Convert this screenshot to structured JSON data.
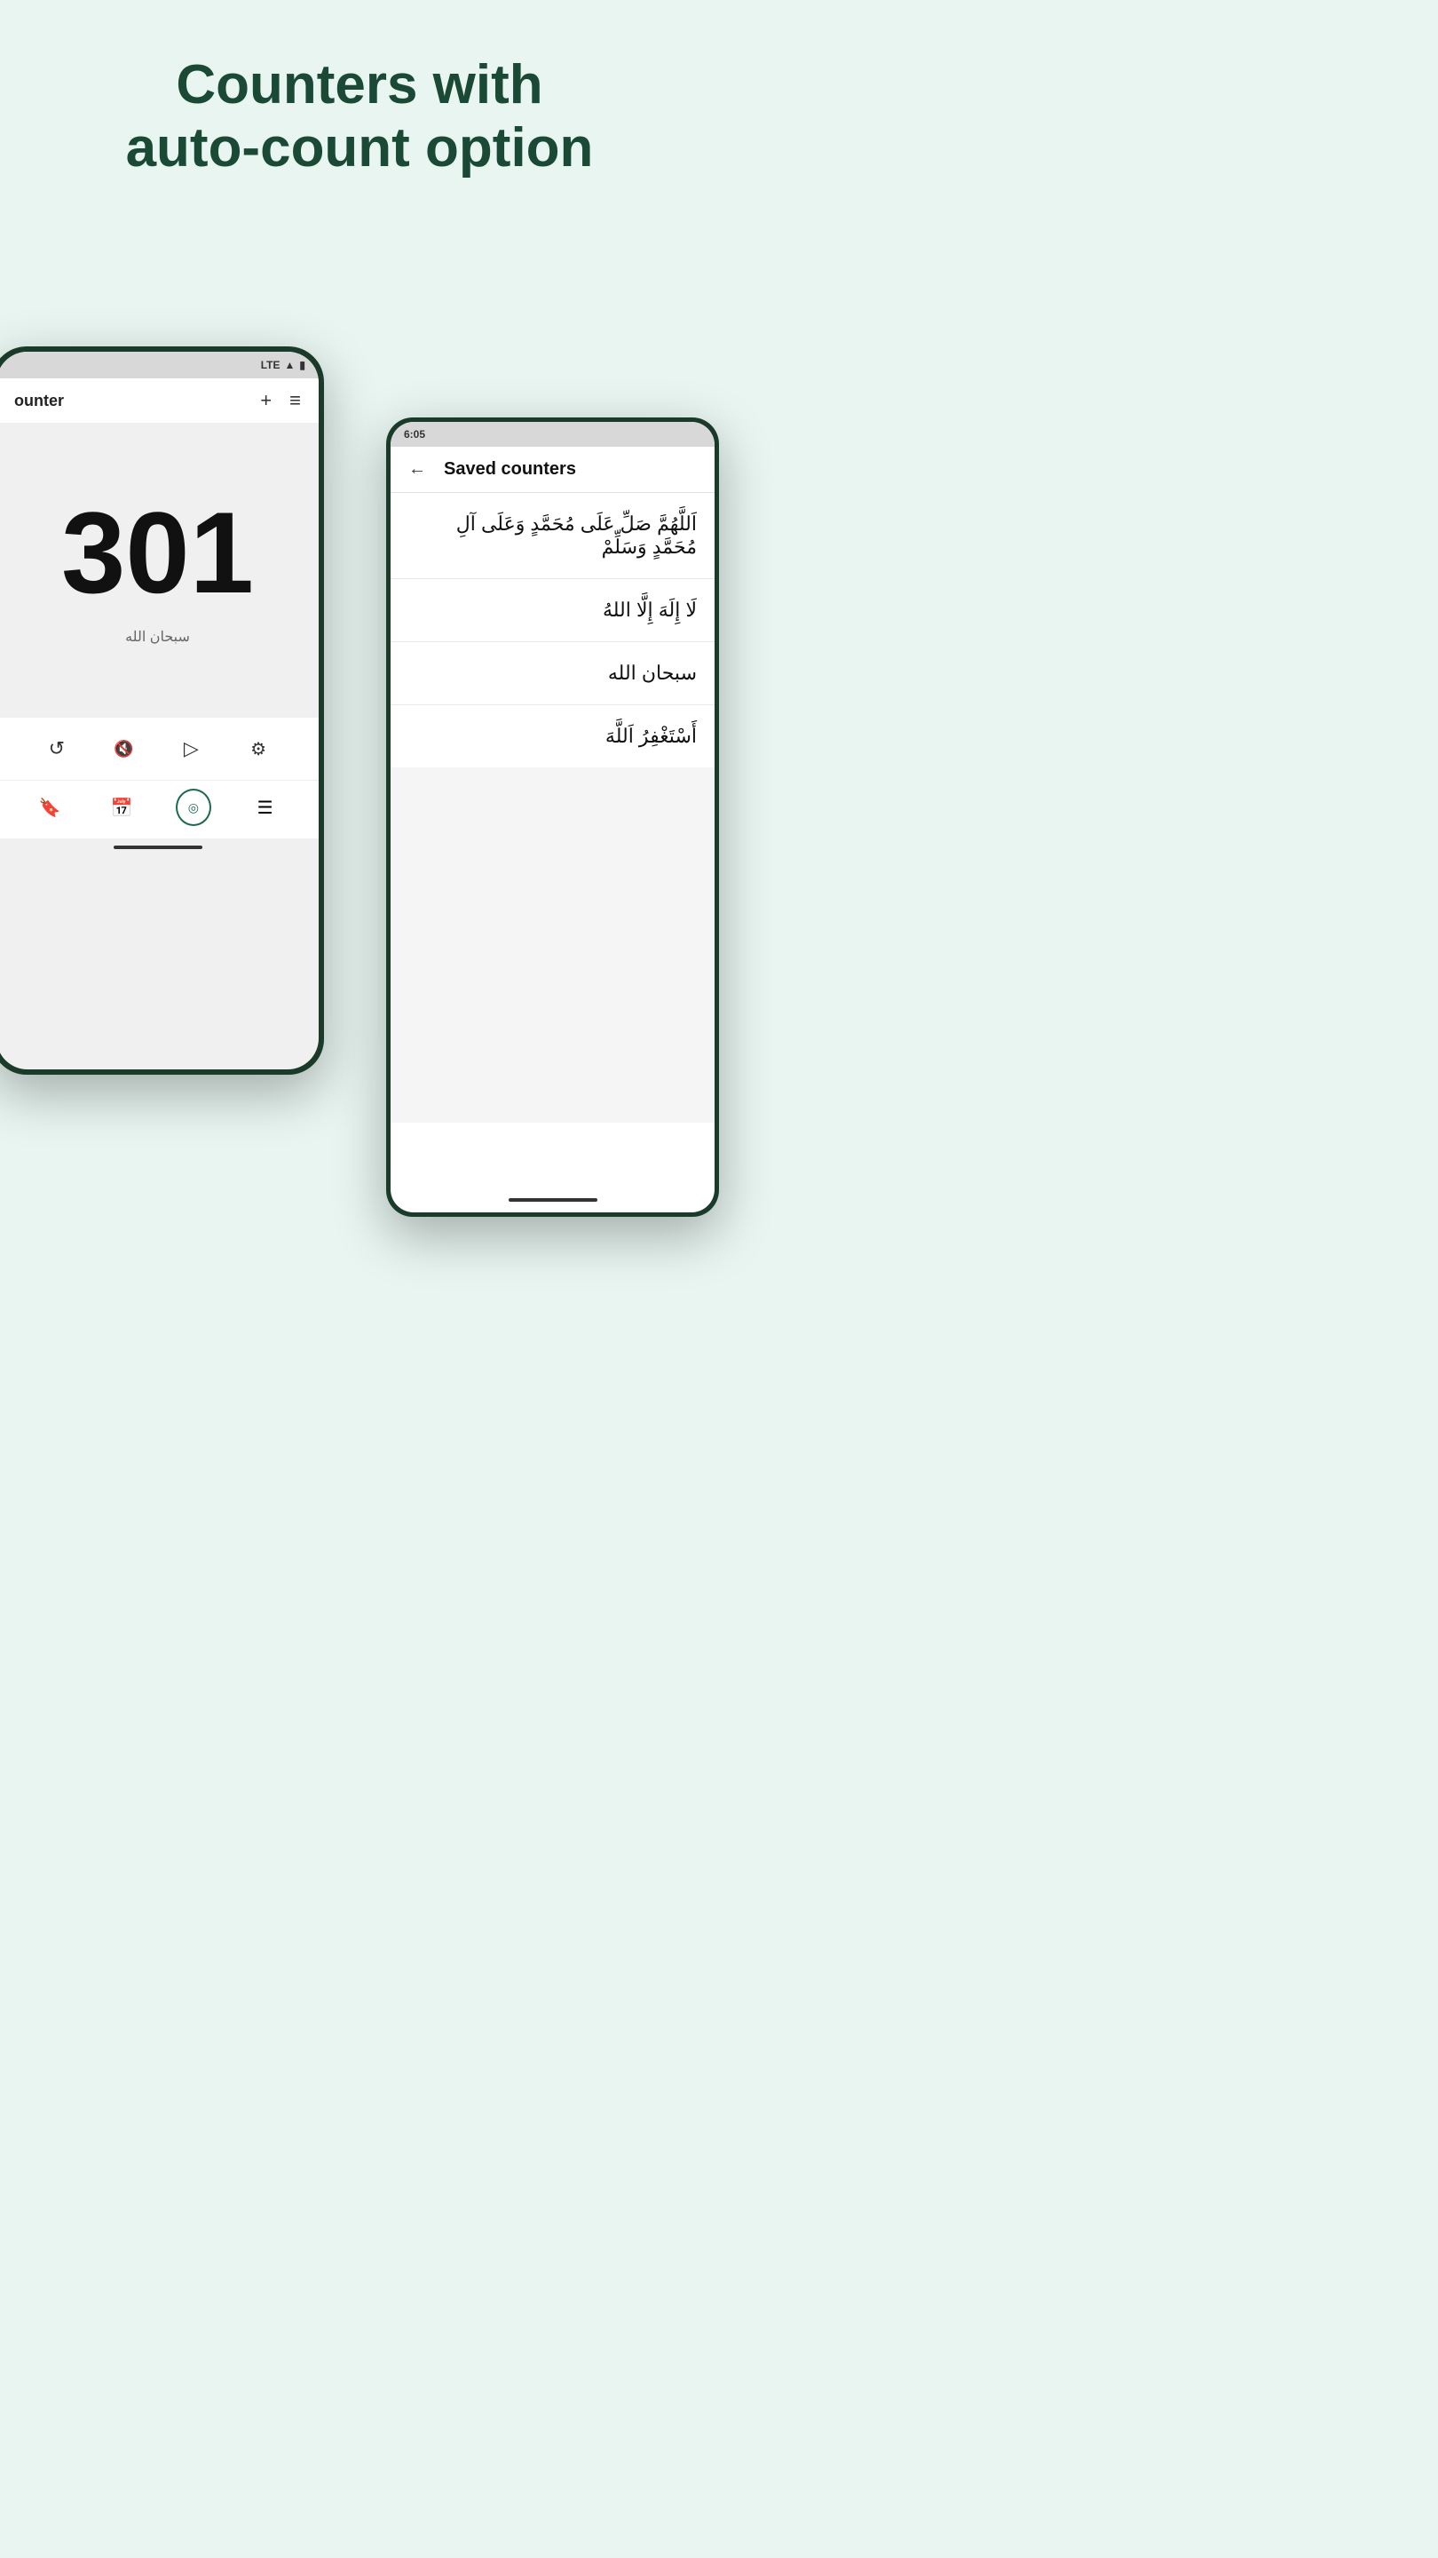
{
  "page": {
    "title_line1": "Counters with",
    "title_line2": "auto-count option",
    "background_color": "#e8f5f0",
    "title_color": "#1a4a35"
  },
  "left_phone": {
    "status_bar": {
      "signal": "LTE",
      "signal_icon": "▲",
      "battery_icon": "🔋"
    },
    "header": {
      "title": "ounter",
      "add_button": "+",
      "menu_button": "≡"
    },
    "counter": {
      "value": "301",
      "label": "سبحان الله"
    },
    "controls": [
      {
        "icon": "↺",
        "name": "reset"
      },
      {
        "icon": "🔇",
        "name": "mute"
      },
      {
        "icon": "▷",
        "name": "play"
      },
      {
        "icon": "⚙",
        "name": "settings"
      }
    ],
    "nav_items": [
      {
        "icon": "🔖",
        "name": "bookmark",
        "active": false
      },
      {
        "icon": "📅",
        "name": "calendar",
        "active": false
      },
      {
        "icon": "◎",
        "name": "counter",
        "active": true
      },
      {
        "icon": "☰",
        "name": "menu",
        "active": false
      }
    ]
  },
  "right_phone": {
    "status_bar": {
      "time": "6:05"
    },
    "header": {
      "back_label": "←",
      "title": "Saved counters"
    },
    "saved_items": [
      {
        "text": "اَللَّهُمَّ صَلِّ عَلَى مُحَمَّدٍ وَعَلَى آلِ مُحَمَّدٍ وَسَلِّمْ"
      },
      {
        "text": "لَا إِلَهَ إِلَّا اللهُ"
      },
      {
        "text": "سبحان الله"
      },
      {
        "text": "أَسْتَغْفِرُ اَللَّهَ"
      }
    ]
  }
}
